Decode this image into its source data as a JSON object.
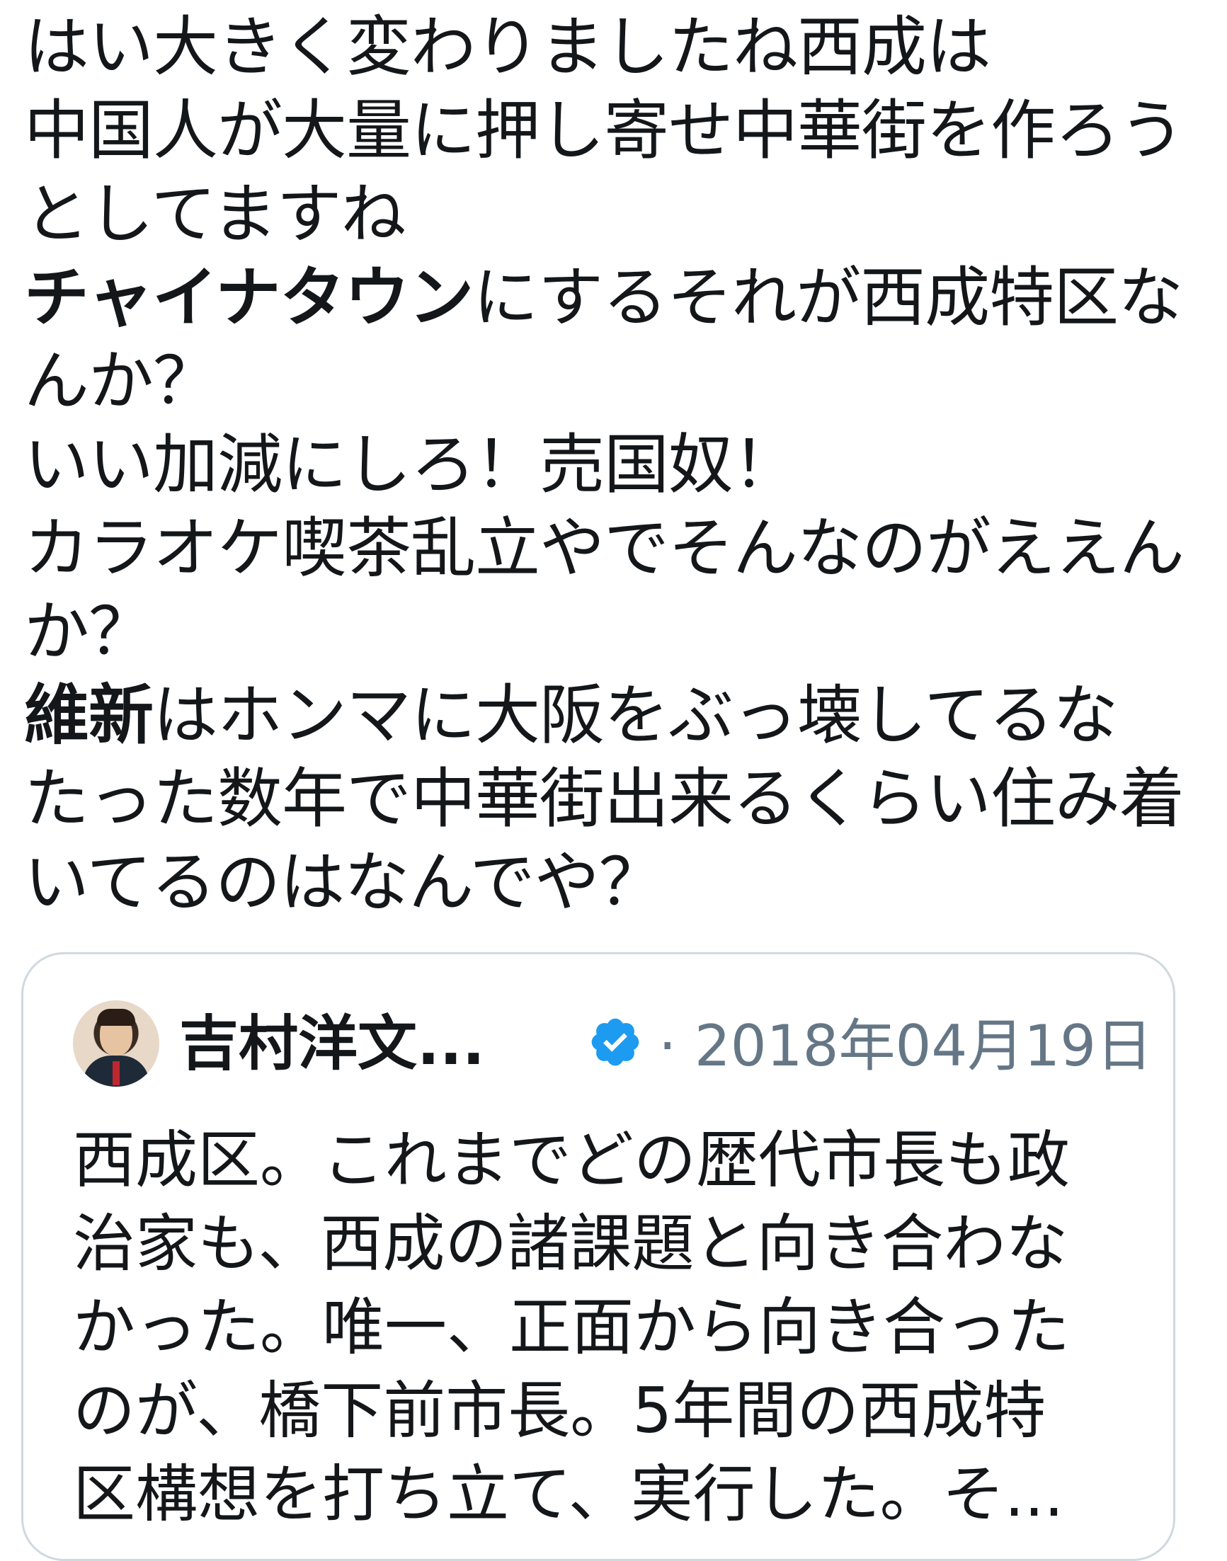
{
  "tweet": {
    "lines": [
      "はい大きく変わりましたね西成は",
      "中国人が大量に押し寄せ中華街を作ろう",
      "としてますね",
      "にするそれが西成特区な",
      "んか？",
      "いい加減にしろ！売国奴！",
      "カラオケ喫茶乱立やでそんなのがええん",
      "か？",
      "はホンマに大阪をぶっ壊してるな",
      "たった数年で中華街出来るくらい住み着",
      "いてるのはなんでや？"
    ],
    "bold_chinatown": "チャイナタウン",
    "bold_ishin": "維新"
  },
  "quote": {
    "author_name": "吉村洋文...",
    "separator": "·",
    "date": "2018年04月19日",
    "verified_icon": "verified-badge-icon",
    "verified_color": "#1d9bf0",
    "lines": [
      "西成区。これまでどの歴代市長も政",
      "治家も、西成の諸課題と向き合わな",
      "かった。唯一、正面から向き合った",
      "のが、橋下前市長。5年間の西成特",
      "区構想を打ち立て、実行した。そ..."
    ]
  }
}
